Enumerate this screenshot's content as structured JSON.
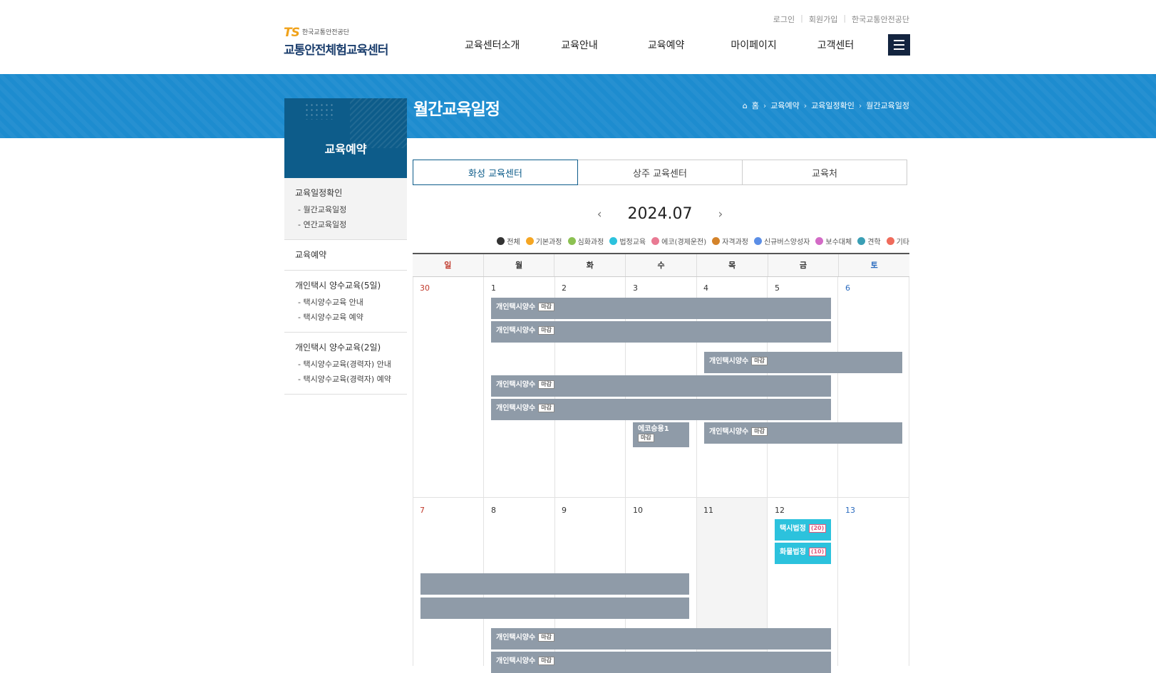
{
  "utility_links": [
    "로그인",
    "회원가입",
    "한국교통안전공단"
  ],
  "logo": {
    "brand": "TS",
    "org": "한국교통안전공단",
    "name": "교통안전체험교육센터"
  },
  "gnb": [
    "교육센터소개",
    "교육안내",
    "교육예약",
    "마이페이지",
    "고객센터"
  ],
  "menu_icon": "hamburger-icon",
  "page_title": "월간교육일정",
  "breadcrumb": {
    "home": "홈",
    "items": [
      "교육예약",
      "교육일정확인",
      "월간교육일정"
    ]
  },
  "lnb": {
    "title": "교육예약",
    "groups": [
      {
        "title": "교육일정확인",
        "active": true,
        "subs": [
          "- 월간교육일정",
          "- 연간교육일정"
        ]
      },
      {
        "title": "교육예약",
        "subs": []
      },
      {
        "title": "개인택시 양수교육(5일)",
        "subs": [
          "- 택시양수교육 안내",
          "- 택시양수교육 예약"
        ]
      },
      {
        "title": "개인택시 양수교육(2일)",
        "subs": [
          "- 택시양수교육(경력자) 안내",
          "- 택시양수교육(경력자) 예약"
        ]
      }
    ]
  },
  "tabs": [
    "화성 교육센터",
    "상주 교육센터",
    "교육처"
  ],
  "month": {
    "label": "2024.07",
    "prev_icon": "chevron-left-icon",
    "next_icon": "chevron-right-icon"
  },
  "legend": [
    {
      "label": "전체",
      "color": "#333333"
    },
    {
      "label": "기본과정",
      "color": "#f5a623"
    },
    {
      "label": "심화과정",
      "color": "#8cc152"
    },
    {
      "label": "법정교육",
      "color": "#2cc2dd"
    },
    {
      "label": "에코(경제운전)",
      "color": "#e97a93"
    },
    {
      "label": "자격과정",
      "color": "#d4832a"
    },
    {
      "label": "신규버스양성자",
      "color": "#5b8ee6"
    },
    {
      "label": "보수대체",
      "color": "#d36bc6"
    },
    {
      "label": "견학",
      "color": "#3a9fb5"
    },
    {
      "label": "기타",
      "color": "#ef6b5b"
    }
  ],
  "weekdays": [
    "일",
    "월",
    "화",
    "수",
    "목",
    "금",
    "토"
  ],
  "weeks": [
    [
      "30",
      "1",
      "2",
      "3",
      "4",
      "5",
      "6"
    ],
    [
      "7",
      "8",
      "9",
      "10",
      "11",
      "12",
      "13"
    ]
  ],
  "events": {
    "week1": {
      "row1": {
        "title": "개인택시양수",
        "badge": "마감"
      },
      "row2": {
        "title": "개인택시양수",
        "badge": "마감"
      },
      "row3": {
        "title": "개인택시양수",
        "badge": "마감"
      },
      "row4": {
        "title": "개인택시양수",
        "badge": "마감"
      },
      "row5": {
        "title": "개인택시양수",
        "badge": "마감"
      },
      "eco": {
        "title": "에코승용1",
        "badge": "마감"
      },
      "row6": {
        "title": "개인택시양수",
        "badge": "마감"
      }
    },
    "week2": {
      "taxi_law": {
        "title": "택시법정",
        "badge": "(20)"
      },
      "cargo_law": {
        "title": "화물법정",
        "badge": "(10)"
      },
      "row1": {
        "title": "개인택시양수",
        "badge": "마감"
      },
      "row2": {
        "title": "개인택시양수",
        "badge": "마감"
      }
    }
  }
}
